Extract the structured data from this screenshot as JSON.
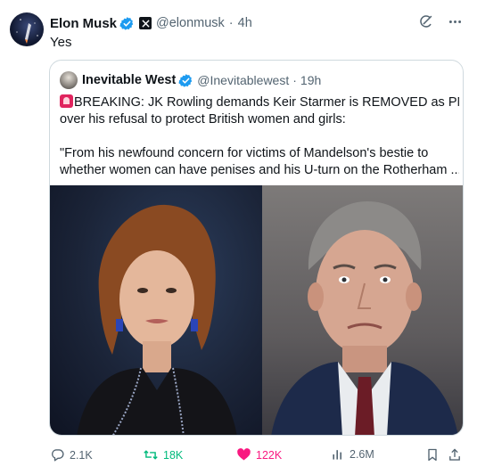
{
  "tweet": {
    "author_name": "Elon Musk",
    "handle": "@elonmusk",
    "time": "4h",
    "text": "Yes"
  },
  "quote": {
    "author_name": "Inevitable West",
    "handle": "@Inevitablewest",
    "time": "19h",
    "line1": "BREAKING: JK Rowling demands Keir Starmer is REMOVED as PM",
    "line2": "over his refusal to protect British women and girls:",
    "line3": "\"From his newfound concern for victims of Mandelson's bestie to",
    "line4": "whether women can have penises and his U-turn on the Rotherham ..."
  },
  "actions": {
    "replies": "2.1K",
    "reposts": "18K",
    "likes": "122K",
    "views": "2.6M"
  },
  "colors": {
    "verified": "#1d9bf0",
    "repost_active": "#00ba7c",
    "like_active": "#f91880",
    "muted": "#536471"
  },
  "icons": {
    "verified": "verified-badge-icon",
    "affiliate": "x-logo-icon",
    "grok": "grok-icon",
    "more": "more-dots-icon",
    "breaking": "siren-emoji-icon",
    "reply": "reply-icon",
    "repost": "repost-icon",
    "like": "heart-icon",
    "views": "views-icon",
    "bookmark": "bookmark-icon",
    "share": "share-icon"
  }
}
